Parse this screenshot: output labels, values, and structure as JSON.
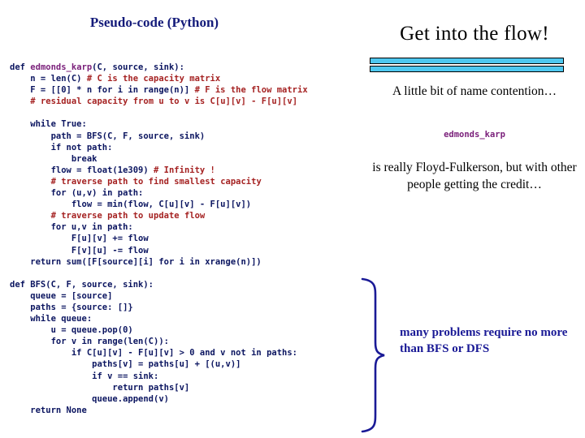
{
  "slide": {
    "left_title": "Pseudo-code (Python)",
    "right_title": "Get into the flow!",
    "note_name_contention": "A little bit of name contention…",
    "note_code_name": "edmonds_karp",
    "note_attribution": "is really Floyd-Fulkerson, but with other people getting the credit…",
    "note_bfs_dfs": "many problems require no more than BFS or DFS",
    "bar_color": "#4ec8f0",
    "title_color": "#141b7a",
    "comment_color": "#a52222",
    "function_name_color": "#7a1f7a",
    "blue_note_color": "#1a1a96"
  },
  "code": {
    "language": "Python",
    "lines": [
      [
        {
          "t": "def ",
          "c": "kw"
        },
        {
          "t": "edmonds_karp",
          "c": "fn"
        },
        {
          "t": "(C, source, sink):",
          "c": "kw"
        }
      ],
      [
        {
          "t": "    n = len(C) ",
          "c": "kw"
        },
        {
          "t": "# C is the capacity matrix",
          "c": "cm"
        }
      ],
      [
        {
          "t": "    F = [[0] * n for i in range(n)] ",
          "c": "kw"
        },
        {
          "t": "# F is the flow matrix",
          "c": "cm"
        }
      ],
      [
        {
          "t": "    ",
          "c": "kw"
        },
        {
          "t": "# residual capacity from u to v is C[u][v] - F[u][v]",
          "c": "cm"
        }
      ],
      [
        {
          "t": "",
          "c": "kw"
        }
      ],
      [
        {
          "t": "    while True:",
          "c": "kw"
        }
      ],
      [
        {
          "t": "        path = BFS(C, F, source, sink)",
          "c": "kw"
        }
      ],
      [
        {
          "t": "        if not path:",
          "c": "kw"
        }
      ],
      [
        {
          "t": "            break",
          "c": "kw"
        }
      ],
      [
        {
          "t": "        flow = float(1e309) ",
          "c": "kw"
        },
        {
          "t": "# Infinity !",
          "c": "cm"
        }
      ],
      [
        {
          "t": "        ",
          "c": "kw"
        },
        {
          "t": "# traverse path to find smallest capacity",
          "c": "cm"
        }
      ],
      [
        {
          "t": "        for (u,v) in path:",
          "c": "kw"
        }
      ],
      [
        {
          "t": "            flow = min(flow, C[u][v] - F[u][v])",
          "c": "kw"
        }
      ],
      [
        {
          "t": "        ",
          "c": "kw"
        },
        {
          "t": "# traverse path to update flow",
          "c": "cm"
        }
      ],
      [
        {
          "t": "        for u,v in path:",
          "c": "kw"
        }
      ],
      [
        {
          "t": "            F[u][v] += flow",
          "c": "kw"
        }
      ],
      [
        {
          "t": "            F[v][u] -= flow",
          "c": "kw"
        }
      ],
      [
        {
          "t": "    return sum([F[source][i] for i in xrange(n)])",
          "c": "kw"
        }
      ],
      [
        {
          "t": "",
          "c": "kw"
        }
      ],
      [
        {
          "t": "def BFS(C, F, source, sink):",
          "c": "kw"
        }
      ],
      [
        {
          "t": "    queue = [source]",
          "c": "kw"
        }
      ],
      [
        {
          "t": "    paths = {source: []}",
          "c": "kw"
        }
      ],
      [
        {
          "t": "    while queue:",
          "c": "kw"
        }
      ],
      [
        {
          "t": "        u = queue.pop(0)",
          "c": "kw"
        }
      ],
      [
        {
          "t": "        for v in range(len(C)):",
          "c": "kw"
        }
      ],
      [
        {
          "t": "            if C[u][v] - F[u][v] > 0 and v not in paths:",
          "c": "kw"
        }
      ],
      [
        {
          "t": "                paths[v] = paths[u] + [(u,v)]",
          "c": "kw"
        }
      ],
      [
        {
          "t": "                if v == sink:",
          "c": "kw"
        }
      ],
      [
        {
          "t": "                    return paths[v]",
          "c": "kw"
        }
      ],
      [
        {
          "t": "                queue.append(v)",
          "c": "kw"
        }
      ],
      [
        {
          "t": "    return None",
          "c": "kw"
        }
      ]
    ]
  }
}
